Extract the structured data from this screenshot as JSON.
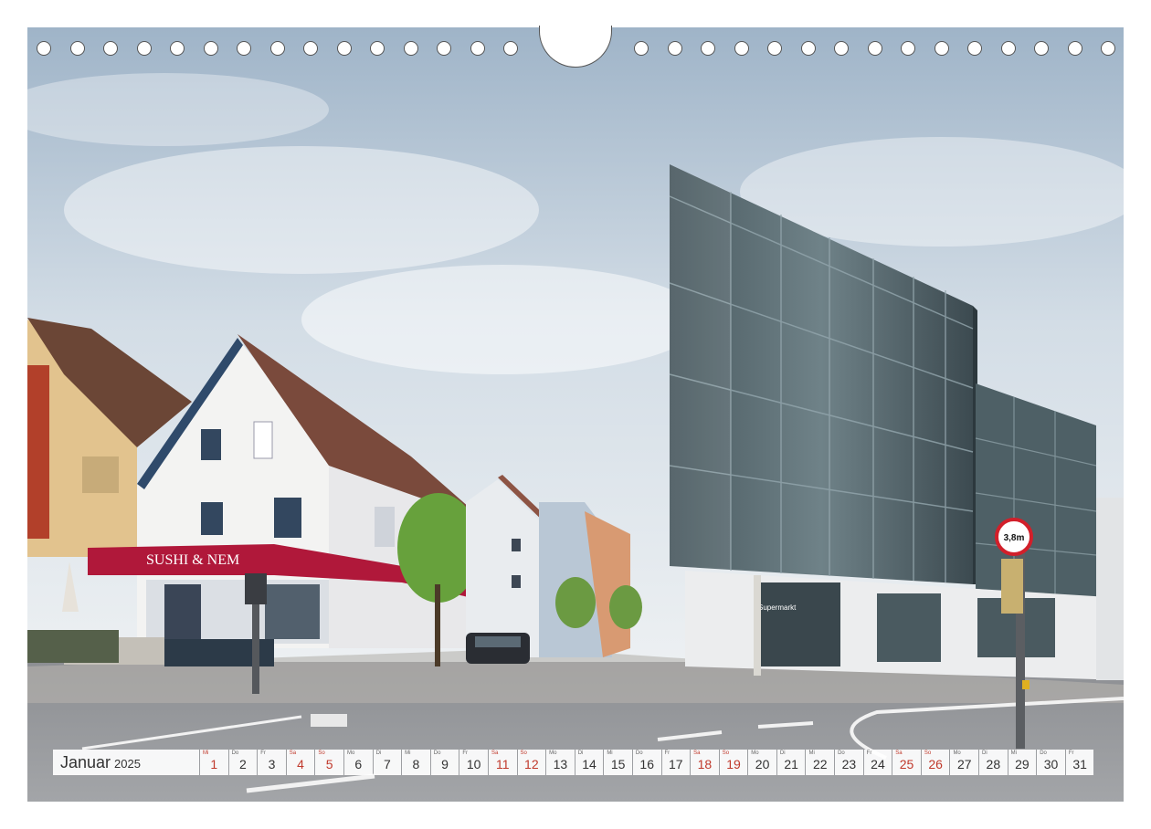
{
  "calendar": {
    "month": "Januar",
    "year": "2025",
    "days": [
      {
        "wd": "Mi",
        "d": "1",
        "red": true
      },
      {
        "wd": "Do",
        "d": "2",
        "red": false
      },
      {
        "wd": "Fr",
        "d": "3",
        "red": false
      },
      {
        "wd": "Sa",
        "d": "4",
        "red": true
      },
      {
        "wd": "So",
        "d": "5",
        "red": true
      },
      {
        "wd": "Mo",
        "d": "6",
        "red": false
      },
      {
        "wd": "Di",
        "d": "7",
        "red": false
      },
      {
        "wd": "Mi",
        "d": "8",
        "red": false
      },
      {
        "wd": "Do",
        "d": "9",
        "red": false
      },
      {
        "wd": "Fr",
        "d": "10",
        "red": false
      },
      {
        "wd": "Sa",
        "d": "11",
        "red": true
      },
      {
        "wd": "So",
        "d": "12",
        "red": true
      },
      {
        "wd": "Mo",
        "d": "13",
        "red": false
      },
      {
        "wd": "Di",
        "d": "14",
        "red": false
      },
      {
        "wd": "Mi",
        "d": "15",
        "red": false
      },
      {
        "wd": "Do",
        "d": "16",
        "red": false
      },
      {
        "wd": "Fr",
        "d": "17",
        "red": false
      },
      {
        "wd": "Sa",
        "d": "18",
        "red": true
      },
      {
        "wd": "So",
        "d": "19",
        "red": true
      },
      {
        "wd": "Mo",
        "d": "20",
        "red": false
      },
      {
        "wd": "Di",
        "d": "21",
        "red": false
      },
      {
        "wd": "Mi",
        "d": "22",
        "red": false
      },
      {
        "wd": "Do",
        "d": "23",
        "red": false
      },
      {
        "wd": "Fr",
        "d": "24",
        "red": false
      },
      {
        "wd": "Sa",
        "d": "25",
        "red": true
      },
      {
        "wd": "So",
        "d": "26",
        "red": true
      },
      {
        "wd": "Mo",
        "d": "27",
        "red": false
      },
      {
        "wd": "Di",
        "d": "28",
        "red": false
      },
      {
        "wd": "Mi",
        "d": "29",
        "red": false
      },
      {
        "wd": "Do",
        "d": "30",
        "red": false
      },
      {
        "wd": "Fr",
        "d": "31",
        "red": false
      }
    ]
  },
  "photo": {
    "shop_sign": "SUSHI & NEM",
    "speed_sign": "3,8m",
    "market_sign": "Supermarkt"
  },
  "colors": {
    "weekend": "#c0392b",
    "sky": "#b9c8d6",
    "sign_red": "#b0183a"
  }
}
